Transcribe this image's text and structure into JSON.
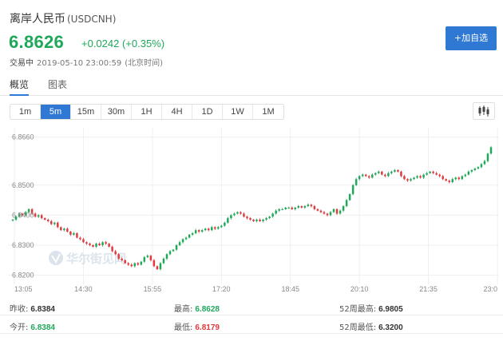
{
  "header": {
    "name": "离岸人民币",
    "code": "(USDCNH)",
    "price": "6.8626",
    "change": "+0.0242 (+0.35%)",
    "status": "交易中",
    "timestamp": "2019-05-10 23:00:59",
    "timezone": "(北京时间)",
    "add_button": "+加自选"
  },
  "tabs": [
    {
      "label": "概览",
      "active": true
    },
    {
      "label": "图表",
      "active": false
    }
  ],
  "periods": [
    {
      "label": "1m",
      "active": false
    },
    {
      "label": "5m",
      "active": true
    },
    {
      "label": "15m",
      "active": false
    },
    {
      "label": "30m",
      "active": false
    },
    {
      "label": "1H",
      "active": false
    },
    {
      "label": "4H",
      "active": false
    },
    {
      "label": "1D",
      "active": false
    },
    {
      "label": "1W",
      "active": false
    },
    {
      "label": "1M",
      "active": false
    }
  ],
  "watermark": "华尔街见闻",
  "colors": {
    "up": "#1fa85a",
    "down": "#e0393e",
    "accent": "#2f78d4"
  },
  "stats": [
    [
      {
        "label": "昨收:",
        "value": "6.8384",
        "color": "dark"
      },
      {
        "label": "最高:",
        "value": "6.8628",
        "color": "green"
      },
      {
        "label": "52周最高:",
        "value": "6.9805",
        "color": "dark"
      }
    ],
    [
      {
        "label": "今开:",
        "value": "6.8384",
        "color": "green"
      },
      {
        "label": "最低:",
        "value": "6.8179",
        "color": "red"
      },
      {
        "label": "52周最低:",
        "value": "6.3200",
        "color": "dark"
      }
    ]
  ],
  "chart_data": {
    "type": "candlestick",
    "y_ticks": [
      "6.8660",
      "6.8500",
      "6.8400",
      "6.8300",
      "6.8200"
    ],
    "x_ticks": [
      "13:05",
      "14:30",
      "15:55",
      "17:20",
      "18:45",
      "20:10",
      "21:35",
      "23:0"
    ],
    "ylim": [
      6.8175,
      6.8675
    ],
    "grid": true,
    "close_path": [
      6.8385,
      6.8395,
      6.8405,
      6.84,
      6.841,
      6.842,
      6.8405,
      6.8395,
      6.84,
      6.839,
      6.8385,
      6.838,
      6.837,
      6.8375,
      6.836,
      6.835,
      6.8355,
      6.8345,
      6.8335,
      6.834,
      6.8325,
      6.832,
      6.831,
      6.8305,
      6.83,
      6.8295,
      6.8305,
      6.83,
      6.831,
      6.8305,
      6.8295,
      6.828,
      6.827,
      6.8255,
      6.825,
      6.824,
      6.8235,
      6.823,
      6.824,
      6.8235,
      6.8245,
      6.826,
      6.8265,
      6.825,
      6.823,
      6.822,
      6.824,
      6.8255,
      6.827,
      6.828,
      6.8285,
      6.83,
      6.831,
      6.832,
      6.8325,
      6.8335,
      6.834,
      6.835,
      6.8345,
      6.835,
      6.8355,
      6.835,
      6.836,
      6.8355,
      6.836,
      6.8365,
      6.8375,
      6.839,
      6.84,
      6.8405,
      6.841,
      6.8405,
      6.8395,
      6.839,
      6.8385,
      6.838,
      6.8385,
      6.838,
      6.8385,
      6.839,
      6.8395,
      6.8405,
      6.8415,
      6.842,
      6.842,
      6.8425,
      6.8425,
      6.842,
      6.8425,
      6.843,
      6.8425,
      6.843,
      6.8435,
      6.843,
      6.842,
      6.8415,
      6.841,
      6.8405,
      6.84,
      6.841,
      6.842,
      6.8405,
      6.8415,
      6.843,
      6.845,
      6.847,
      6.85,
      6.852,
      6.853,
      6.8535,
      6.853,
      6.8525,
      6.8535,
      6.854,
      6.8545,
      6.8535,
      6.853,
      6.854,
      6.8545,
      6.855,
      6.8545,
      6.853,
      6.852,
      6.8515,
      6.852,
      6.8525,
      6.853,
      6.8525,
      6.8535,
      6.854,
      6.8545,
      6.854,
      6.8535,
      6.853,
      6.852,
      6.8515,
      6.851,
      6.852,
      6.8525,
      6.852,
      6.853,
      6.8535,
      6.8545,
      6.855,
      6.8555,
      6.856,
      6.857,
      6.858,
      6.8605,
      6.8626
    ]
  }
}
